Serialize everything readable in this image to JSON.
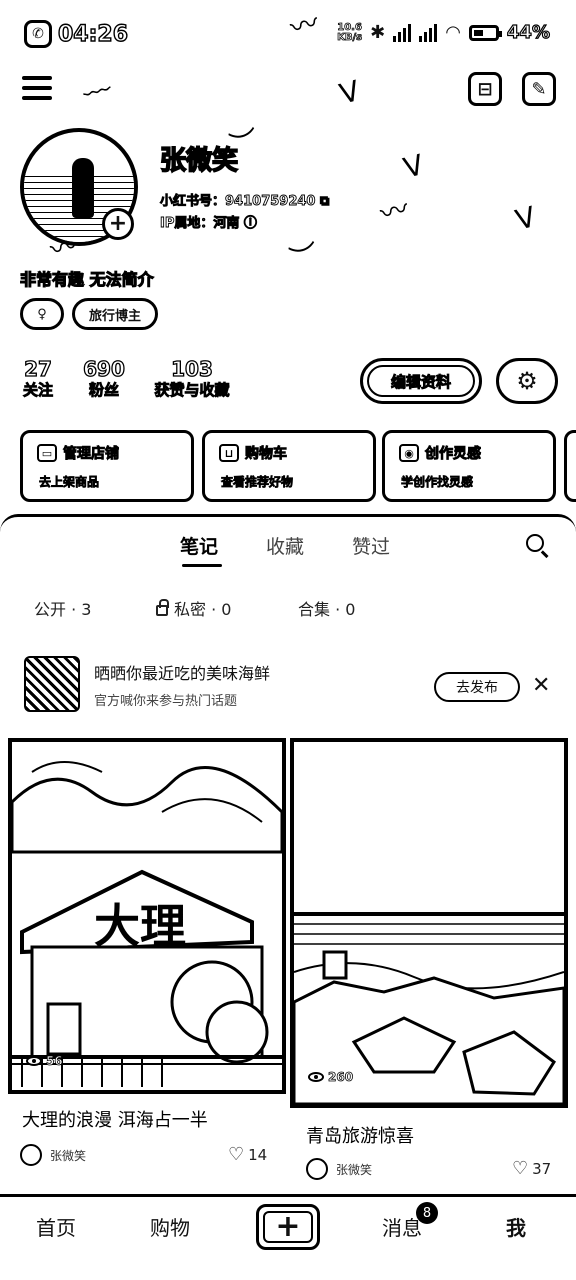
{
  "status_bar": {
    "time": "04:26",
    "net_rate_top": "10.6",
    "net_rate_bottom": "KB/s",
    "bluetooth": "✱",
    "wifi": "◠",
    "battery_percent": "44%",
    "battery_level": 0.44
  },
  "profile": {
    "name": "张微笑",
    "red_id_label": "小红书号：",
    "red_id": "9410759240",
    "ip_label": "IP属地：",
    "ip_location": "河南",
    "bio": "非常有趣 无法简介",
    "tags": [
      "♀",
      "旅行博主"
    ]
  },
  "stats": [
    {
      "num": "27",
      "label": "关注"
    },
    {
      "num": "690",
      "label": "粉丝"
    },
    {
      "num": "103",
      "label": "获赞与收藏"
    }
  ],
  "actions": {
    "edit_profile": "编辑资料",
    "settings_icon": "gear-icon"
  },
  "service_cards": [
    {
      "title": "管理店铺",
      "subtitle": "去上架商品",
      "icon": "shop-icon"
    },
    {
      "title": "购物车",
      "subtitle": "查看推荐好物",
      "icon": "cart-icon"
    },
    {
      "title": "创作灵感",
      "subtitle": "学创作找灵感",
      "icon": "bulb-icon"
    }
  ],
  "tabs": [
    "笔记",
    "收藏",
    "赞过"
  ],
  "active_tab": "笔记",
  "filters": {
    "public": "公开 · 3",
    "private": "私密 · 0",
    "collection": "合集 · 0"
  },
  "promo": {
    "title": "晒晒你最近吃的美味海鲜",
    "subtitle": "官方喊你来参与热门话题",
    "button": "去发布",
    "close": "✕"
  },
  "notes": [
    {
      "title": "大理的浪漫 洱海占一半",
      "author": "张微笑",
      "likes": "14",
      "views": "56",
      "sign_text": "大理"
    },
    {
      "title": "青岛旅游惊喜",
      "author": "张微笑",
      "likes": "37",
      "views": "260"
    }
  ],
  "bottom_nav": {
    "home": "首页",
    "shop": "购物",
    "add": "+",
    "messages": "消息",
    "messages_badge": "8",
    "me": "我"
  }
}
